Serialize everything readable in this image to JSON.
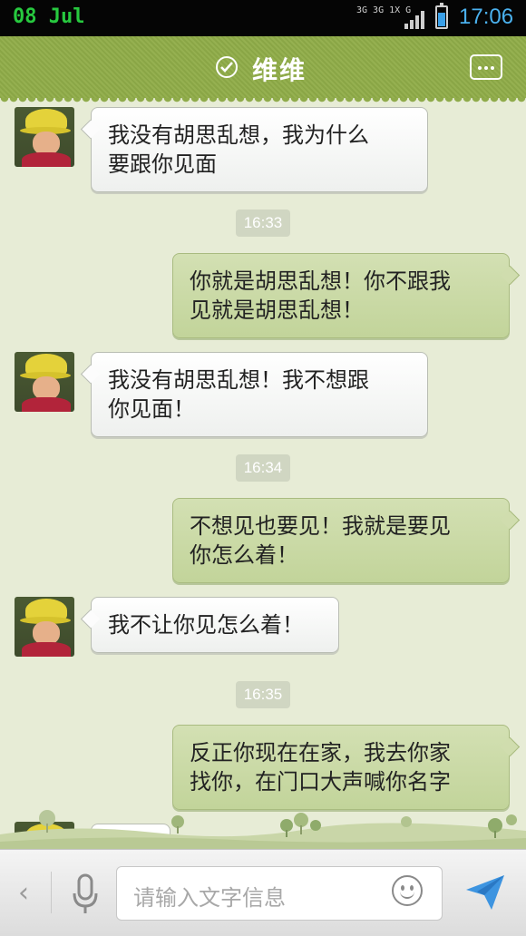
{
  "status_bar": {
    "date": "08  Jul",
    "network": "3G 3G 1X G",
    "time": "17:06"
  },
  "header": {
    "contact_name": "维维"
  },
  "messages": [
    {
      "type": "incoming",
      "lines": [
        "我没有胡思乱想，我为什么",
        "要跟你见面"
      ]
    },
    {
      "type": "timestamp",
      "text": "16:33"
    },
    {
      "type": "outgoing",
      "lines": [
        "你就是胡思乱想！你不跟我",
        "见就是胡思乱想！"
      ]
    },
    {
      "type": "incoming",
      "lines": [
        "我没有胡思乱想！我不想跟",
        "你见面！"
      ]
    },
    {
      "type": "timestamp",
      "text": "16:34"
    },
    {
      "type": "outgoing",
      "lines": [
        "不想见也要见！我就是要见",
        "你怎么着！"
      ]
    },
    {
      "type": "incoming",
      "lines": [
        "我不让你见怎么着！"
      ]
    },
    {
      "type": "timestamp",
      "text": "16:35"
    },
    {
      "type": "outgoing",
      "lines": [
        "反正你现在在家，我去你家",
        "找你，在门口大声喊你名字"
      ]
    }
  ],
  "input": {
    "placeholder": "请输入文字信息"
  },
  "icons": {
    "header": [
      "verified-check-icon",
      "more-icon"
    ],
    "bottom": [
      "back-chevron-icon",
      "microphone-icon",
      "emoji-icon",
      "send-icon"
    ]
  },
  "colors": {
    "header_green": "#8aa646",
    "outgoing_bubble": "#c9d9a4",
    "incoming_bubble": "#ffffff",
    "time_blue": "#4ab1ee"
  }
}
